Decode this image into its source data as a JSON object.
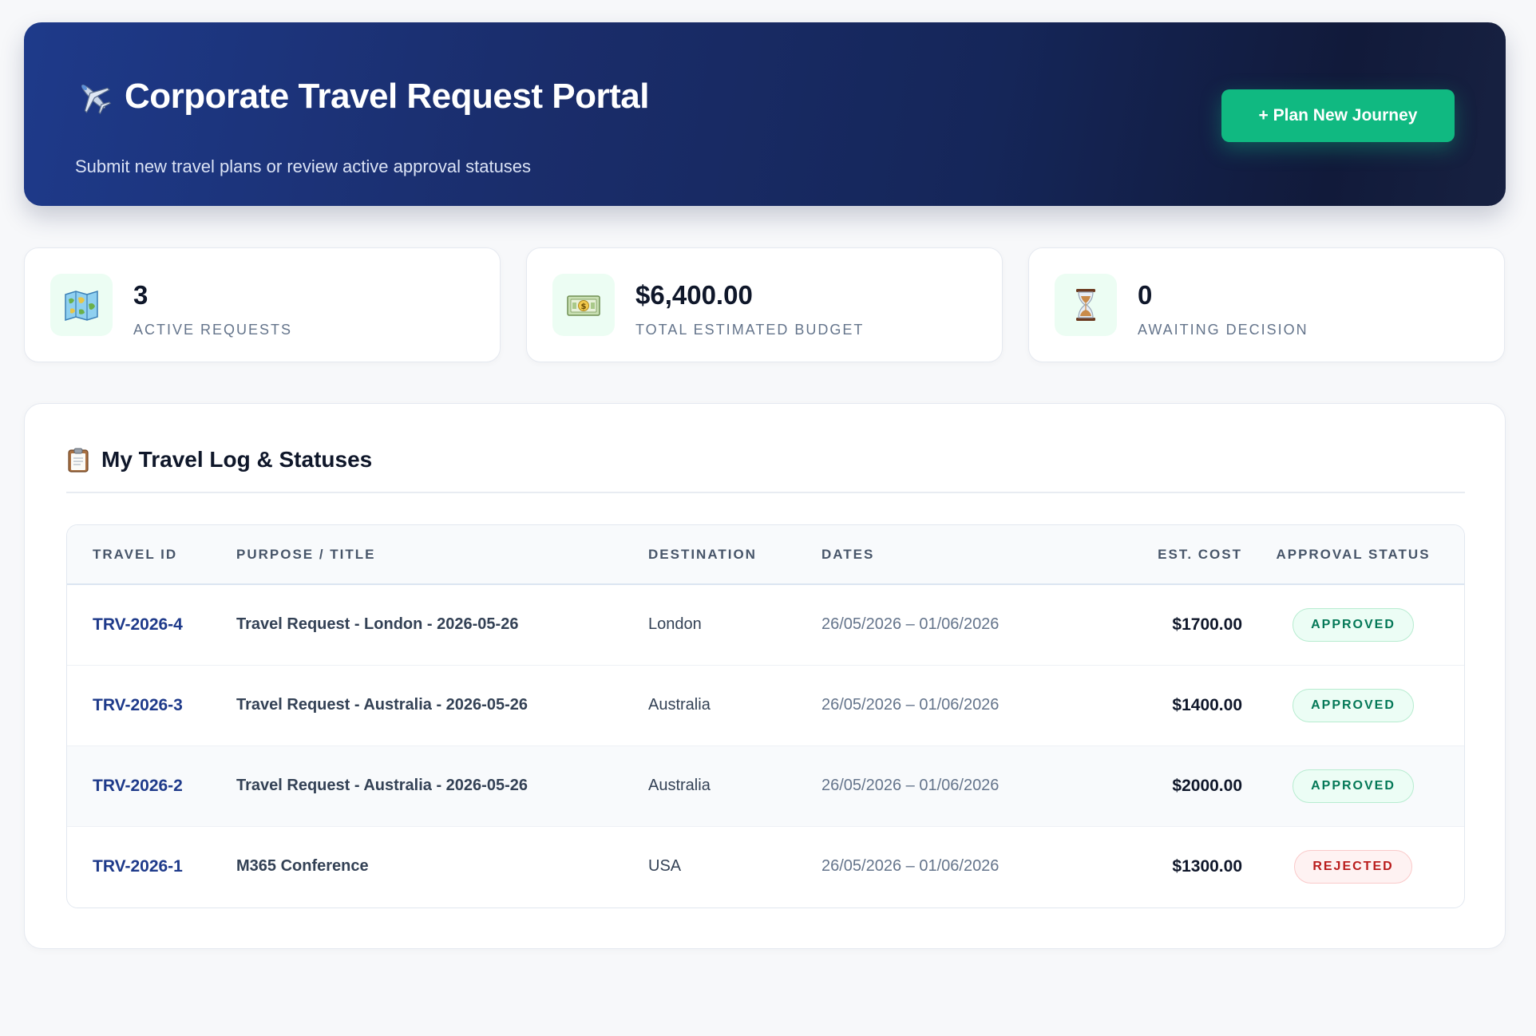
{
  "header": {
    "title": "Corporate Travel Request Portal",
    "subtitle": "Submit new travel plans or review active approval statuses",
    "new_button": "+ Plan New Journey"
  },
  "stats": [
    {
      "value": "3",
      "label": "Active Requests",
      "icon": "map-icon"
    },
    {
      "value": "$6,400.00",
      "label": "Total Estimated Budget",
      "icon": "money-icon"
    },
    {
      "value": "0",
      "label": "Awaiting Decision",
      "icon": "hourglass-icon"
    }
  ],
  "log": {
    "title": "My Travel Log & Statuses",
    "columns": [
      "Travel ID",
      "Purpose / Title",
      "Destination",
      "Dates",
      "Est. Cost",
      "Approval Status"
    ],
    "rows": [
      {
        "id": "TRV-2026-4",
        "purpose": "Travel Request - London - 2026-05-26",
        "destination": "London",
        "dates": "26/05/2026 – 01/06/2026",
        "cost": "$1700.00",
        "status": "Approved",
        "status_type": "approved"
      },
      {
        "id": "TRV-2026-3",
        "purpose": "Travel Request - Australia - 2026-05-26",
        "destination": "Australia",
        "dates": "26/05/2026 – 01/06/2026",
        "cost": "$1400.00",
        "status": "Approved",
        "status_type": "approved"
      },
      {
        "id": "TRV-2026-2",
        "purpose": "Travel Request - Australia - 2026-05-26",
        "destination": "Australia",
        "dates": "26/05/2026 – 01/06/2026",
        "cost": "$2000.00",
        "status": "Approved",
        "status_type": "approved"
      },
      {
        "id": "TRV-2026-1",
        "purpose": "M365 Conference",
        "destination": "USA",
        "dates": "26/05/2026 – 01/06/2026",
        "cost": "$1300.00",
        "status": "Rejected",
        "status_type": "rejected"
      }
    ]
  },
  "colors": {
    "brand_navy": "#1e3a8a",
    "accent_green": "#10b981",
    "approved": "#047857",
    "rejected": "#b91c1c"
  }
}
